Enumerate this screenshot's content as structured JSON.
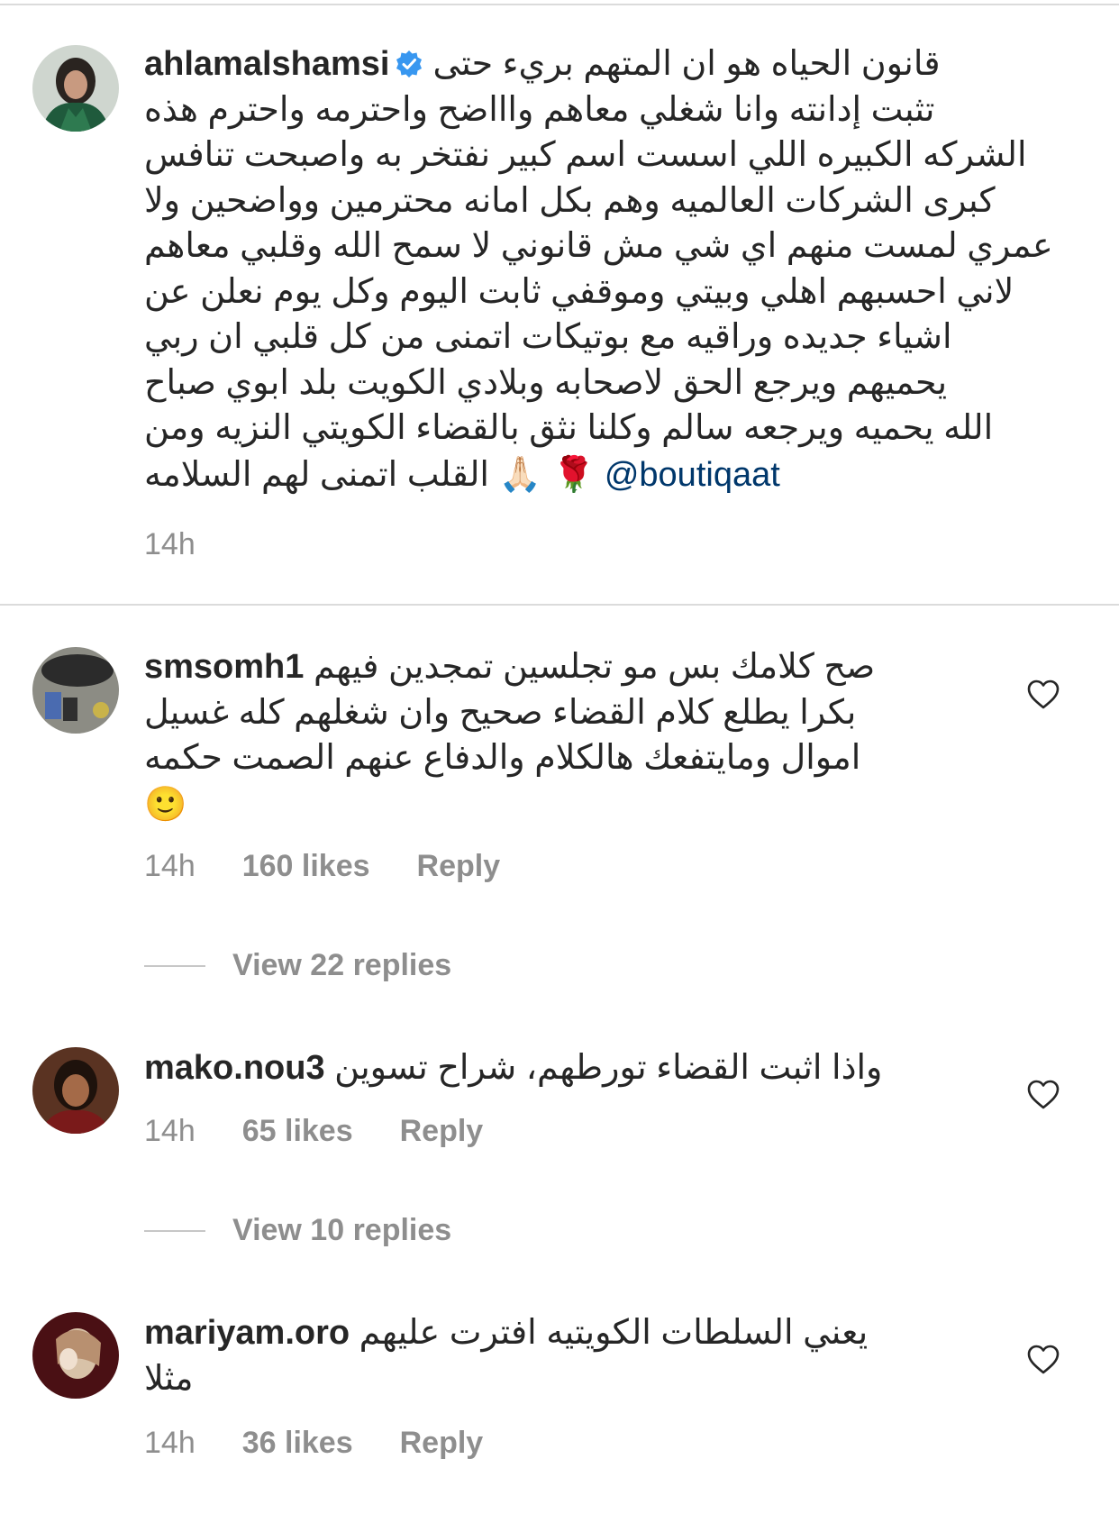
{
  "post": {
    "username": "ahlamalshamsi",
    "lines": [
      "قانون الحياه هو ان المتهم بريء حتى",
      "تثبت إدانته وانا شغلي معاهم واااضح واحترمه واحترم هذه",
      "الشركه الكبيره اللي اسست اسم كبير نفتخر به واصبحت تنافس",
      "كبرى الشركات العالميه وهم بكل امانه محترمين وواضحين ولا",
      "عمري لمست منهم اي شي مش قانوني لا سمح الله وقلبي معاهم",
      "لاني احسبهم اهلي وبيتي وموقفي ثابت اليوم وكل يوم نعلن عن",
      "اشياء جديده وراقيه مع بوتيكات اتمنى من كل قلبي ان ربي",
      "يحميهم ويرجع الحق لاصحابه وبلادي الكويت بلد ابوي صباح",
      "الله يحميه ويرجعه سالم وكلنا نثق بالقضاء الكويتي النزيه ومن"
    ],
    "last_line_text": "القلب اتمنى لهم السلامه",
    "last_line_emojis": "🙏🏻 🌹",
    "mention": "@boutiqaat",
    "time": "14h"
  },
  "comments": [
    {
      "username": "smsomh1",
      "first_line_text": "صح كلامك بس مو تجلسين تمجدين فيهم",
      "lines": [
        "بكرا يطلع كلام القضاء صحيح وان شغلهم كله غسيل",
        "اموال ومايتفعك هالكلام والدفاع عنهم الصمت حكمه"
      ],
      "emoji": "🙂",
      "time": "14h",
      "likes": "160 likes",
      "reply": "Reply",
      "view_replies": "View 22 replies"
    },
    {
      "username": "mako.nou3",
      "first_line_text": "واذا اثبت القضاء تورطهم، شراح تسوين",
      "lines": [],
      "time": "14h",
      "likes": "65 likes",
      "reply": "Reply",
      "view_replies": "View 10 replies"
    },
    {
      "username": "mariyam.oro",
      "first_line_text": "يعني السلطات الكويتيه افترت عليهم",
      "lines": [
        "مثلا"
      ],
      "time": "14h",
      "likes": "36 likes",
      "reply": "Reply"
    }
  ],
  "colors": {
    "text": "#262626",
    "muted": "#8e8e8e",
    "link": "#00376b",
    "verified": "#3897f0",
    "divider": "#dbdbdb"
  },
  "icons": {
    "verified": "verified-badge-icon",
    "like": "heart-outline-icon"
  }
}
